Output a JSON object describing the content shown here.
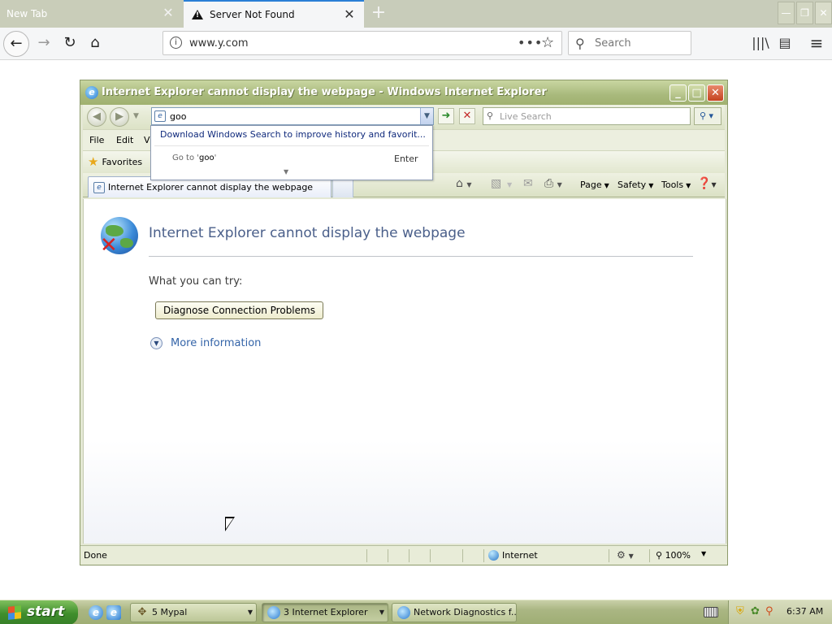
{
  "firefox": {
    "tabs": [
      {
        "label": "New Tab",
        "active": false
      },
      {
        "label": "Server Not Found",
        "active": true
      }
    ],
    "url": "www.y.com",
    "search_placeholder": "Search",
    "dots": "•••",
    "icons": {
      "back": "←",
      "forward": "→",
      "reload": "↻",
      "home": "⌂",
      "star": "☆",
      "search": "⚲",
      "library": "|||\\",
      "sidebar": "▤",
      "menu": "≡",
      "close": "✕",
      "newtab": "+",
      "minimize": "—",
      "restore": "❐"
    }
  },
  "ie": {
    "window_title": "Internet Explorer cannot display the webpage - Windows Internet Explorer",
    "address_value": "goo",
    "live_search_placeholder": "Live Search",
    "menu": [
      "File",
      "Edit",
      "Vi"
    ],
    "favorites_label": "Favorites",
    "tab_label": "Internet Explorer cannot display the webpage",
    "commands": {
      "page": "Page",
      "safety": "Safety",
      "tools": "Tools"
    },
    "error": {
      "title": "Internet Explorer cannot display the webpage",
      "try_label": "What you can try:",
      "diagnose_button": "Diagnose Connection Problems",
      "more_info": "More information"
    },
    "status": {
      "text": "Done",
      "zone": "Internet",
      "zoom": "100%"
    },
    "autocomplete": {
      "link": "Download Windows Search to improve history and favorit...",
      "goto_prefix": "Go to '",
      "goto_value": "goo",
      "goto_suffix": "'",
      "enter_label": "Enter"
    }
  },
  "taskbar": {
    "start_label": "start",
    "buttons": [
      {
        "label": "5 Mypal"
      },
      {
        "label": "3 Internet Explorer"
      },
      {
        "label": "Network Diagnostics f..."
      }
    ],
    "clock": "6:37 AM"
  }
}
